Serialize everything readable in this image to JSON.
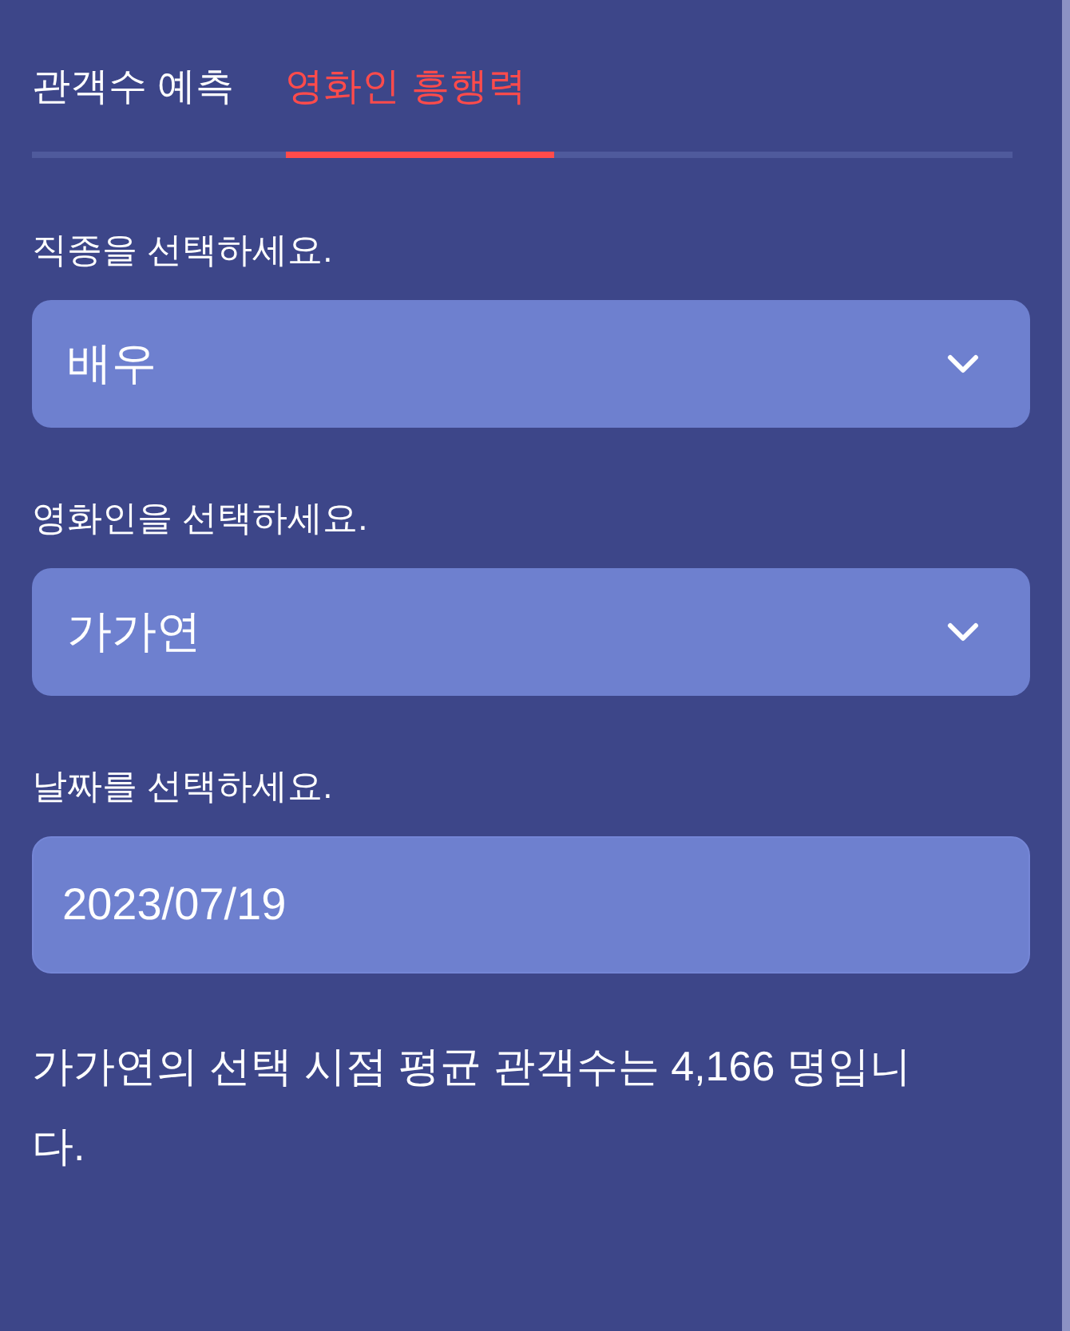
{
  "tabs": [
    {
      "label": "관객수 예측",
      "selected": false
    },
    {
      "label": "영화인 흥행력",
      "selected": true
    }
  ],
  "fields": [
    {
      "kind": "select",
      "label": "직종을 선택하세요.",
      "value": "배우"
    },
    {
      "kind": "select",
      "label": "영화인을 선택하세요.",
      "value": "가가연"
    },
    {
      "kind": "date",
      "label": "날짜를 선택하세요.",
      "value": "2023/07/19"
    }
  ],
  "result": "가가연의 선택 시점 평균 관객수는 4,166 명입니다."
}
